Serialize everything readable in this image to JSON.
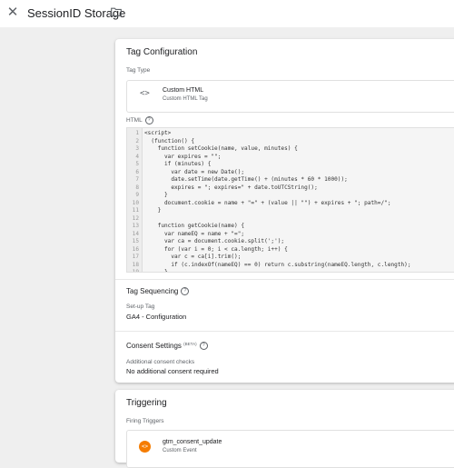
{
  "header": {
    "title": "SessionID Storage",
    "close_icon": "close-icon",
    "folder_icon": "folder-icon"
  },
  "tag_configuration": {
    "heading": "Tag Configuration",
    "tag_type_label": "Tag Type",
    "tag_type_name": "Custom HTML",
    "tag_type_sub": "Custom HTML Tag",
    "tag_type_icon": "code-icon",
    "html_label": "HTML",
    "code_lines": [
      {
        "n": "1",
        "t": "<script>"
      },
      {
        "n": "2",
        "t": "  (function() {"
      },
      {
        "n": "3",
        "t": "    function setCookie(name, value, minutes) {"
      },
      {
        "n": "4",
        "t": "      var expires = \"\";"
      },
      {
        "n": "5",
        "t": "      if (minutes) {"
      },
      {
        "n": "6",
        "t": "        var date = new Date();"
      },
      {
        "n": "7",
        "t": "        date.setTime(date.getTime() + (minutes * 60 * 1000));"
      },
      {
        "n": "8",
        "t": "        expires = \"; expires=\" + date.toUTCString();"
      },
      {
        "n": "9",
        "t": "      }"
      },
      {
        "n": "10",
        "t": "      document.cookie = name + \"=\" + (value || \"\") + expires + \"; path=/\";"
      },
      {
        "n": "11",
        "t": "    }"
      },
      {
        "n": "12",
        "t": ""
      },
      {
        "n": "13",
        "t": "    function getCookie(name) {"
      },
      {
        "n": "14",
        "t": "      var nameEQ = name + \"=\";"
      },
      {
        "n": "15",
        "t": "      var ca = document.cookie.split(';');"
      },
      {
        "n": "16",
        "t": "      for (var i = 0; i < ca.length; i++) {"
      },
      {
        "n": "17",
        "t": "        var c = ca[i].trim();"
      },
      {
        "n": "18",
        "t": "        if (c.indexOf(nameEQ) == 0) return c.substring(nameEQ.length, c.length);"
      },
      {
        "n": "19",
        "t": "      }"
      }
    ],
    "sequencing_heading": "Tag Sequencing",
    "setup_tag_label": "Set-up Tag",
    "setup_tag_value": "GA4 - Configuration",
    "consent_heading": "Consent Settings",
    "consent_beta": "(BETA)",
    "consent_checks_label": "Additional consent checks",
    "consent_checks_value": "No additional consent required"
  },
  "triggering": {
    "heading": "Triggering",
    "firing_label": "Firing Triggers",
    "trigger_name": "gtm_consent_update",
    "trigger_type": "Custom Event",
    "trigger_icon": "custom-event-icon",
    "trigger_color": "#f57c00"
  }
}
